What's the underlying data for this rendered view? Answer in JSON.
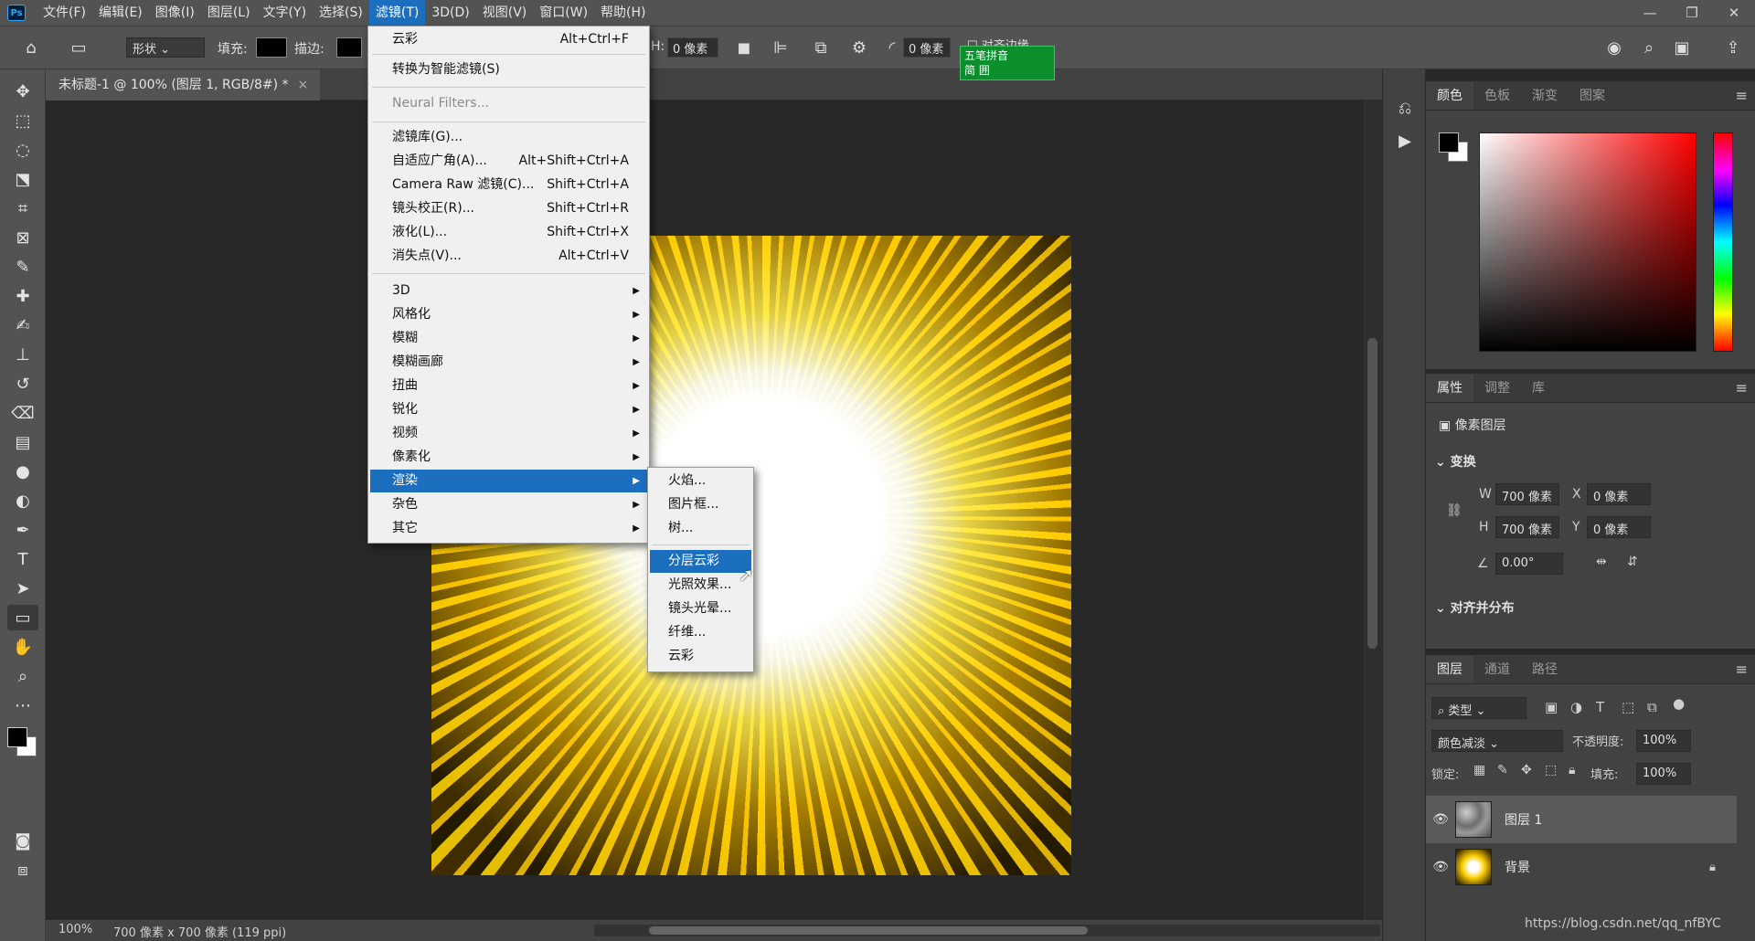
{
  "menubar": {
    "logo": "Ps",
    "items": [
      "文件(F)",
      "编辑(E)",
      "图像(I)",
      "图层(L)",
      "文字(Y)",
      "选择(S)",
      "滤镜(T)",
      "3D(D)",
      "视图(V)",
      "窗口(W)",
      "帮助(H)"
    ],
    "active": "滤镜(T)",
    "window_controls": [
      "—",
      "❐",
      "✕"
    ]
  },
  "options": {
    "shape_mode": "形状",
    "fill_label": "填充:",
    "stroke_label": "描边:",
    "width_label": "H:",
    "width_value": "0 像素",
    "radius_value": "0 像素",
    "align_edges": "对齐边缘"
  },
  "ime": {
    "line1": "五笔拼音",
    "line2": "简 囲"
  },
  "document": {
    "tab_title": "未标题-1 @ 100% (图层 1, RGB/8#) *",
    "tab_close": "×"
  },
  "status": {
    "zoom": "100%",
    "doc_info": "700 像素 x 700 像素 (119 ppi)"
  },
  "color_panel": {
    "tabs": [
      "颜色",
      "色板",
      "渐变",
      "图案"
    ],
    "active_tab": "颜色",
    "foreground": "#000000",
    "background": "#ffffff"
  },
  "properties_panel": {
    "tabs": [
      "属性",
      "调整",
      "库"
    ],
    "active_tab": "属性",
    "layer_type": "像素图层",
    "transform_title": "变换",
    "w_label": "W",
    "w_value": "700 像素",
    "x_label": "X",
    "x_value": "0 像素",
    "h_label": "H",
    "h_value": "700 像素",
    "y_label": "Y",
    "y_value": "0 像素",
    "angle_value": "0.00°",
    "align_title": "对齐并分布"
  },
  "layers_panel": {
    "tabs": [
      "图层",
      "通道",
      "路径"
    ],
    "active_tab": "图层",
    "filter_kind": "类型",
    "blend_mode": "颜色减淡",
    "opacity_label": "不透明度:",
    "opacity_value": "100%",
    "lock_label": "锁定:",
    "fill_label": "填充:",
    "fill_value": "100%",
    "layers": [
      {
        "name": "图层 1",
        "selected": true,
        "locked": false
      },
      {
        "name": "背景",
        "selected": false,
        "locked": true
      }
    ]
  },
  "filter_menu": {
    "items": [
      {
        "label": "云彩",
        "shortcut": "Alt+Ctrl+F"
      },
      {
        "label": "转换为智能滤镜(S)",
        "shortcut": ""
      },
      {
        "label": "Neural Filters...",
        "shortcut": "",
        "disabled": true
      },
      {
        "label": "滤镜库(G)...",
        "shortcut": ""
      },
      {
        "label": "自适应广角(A)...",
        "shortcut": "Alt+Shift+Ctrl+A"
      },
      {
        "label": "Camera Raw 滤镜(C)...",
        "shortcut": "Shift+Ctrl+A"
      },
      {
        "label": "镜头校正(R)...",
        "shortcut": "Shift+Ctrl+R"
      },
      {
        "label": "液化(L)...",
        "shortcut": "Shift+Ctrl+X"
      },
      {
        "label": "消失点(V)...",
        "shortcut": "Alt+Ctrl+V"
      },
      {
        "label": "3D",
        "submenu": true
      },
      {
        "label": "风格化",
        "submenu": true
      },
      {
        "label": "模糊",
        "submenu": true
      },
      {
        "label": "模糊画廊",
        "submenu": true
      },
      {
        "label": "扭曲",
        "submenu": true
      },
      {
        "label": "锐化",
        "submenu": true
      },
      {
        "label": "视频",
        "submenu": true
      },
      {
        "label": "像素化",
        "submenu": true
      },
      {
        "label": "渲染",
        "submenu": true,
        "highlight": true
      },
      {
        "label": "杂色",
        "submenu": true
      },
      {
        "label": "其它",
        "submenu": true
      }
    ]
  },
  "render_submenu": {
    "items": [
      "火焰...",
      "图片框...",
      "树...",
      "分层云彩",
      "光照效果...",
      "镜头光晕...",
      "纤维...",
      "云彩"
    ],
    "highlight": "分层云彩"
  },
  "watermark": "https://blog.csdn.net/qq_nfBYC"
}
